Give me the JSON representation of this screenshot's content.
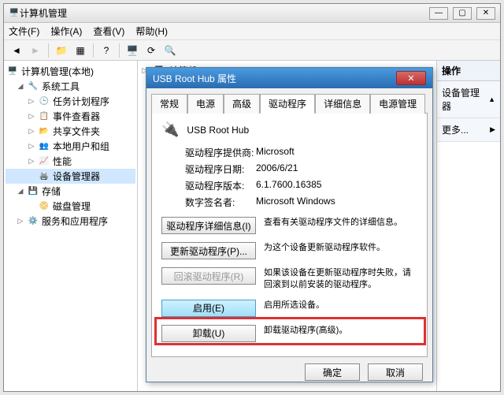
{
  "window": {
    "title": "计算机管理"
  },
  "menubar": {
    "file": "文件(F)",
    "action": "操作(A)",
    "view": "查看(V)",
    "help": "帮助(H)"
  },
  "tree": {
    "root": "计算机管理(本地)",
    "system_tools": "系统工具",
    "task_scheduler": "任务计划程序",
    "event_viewer": "事件查看器",
    "shared_folders": "共享文件夹",
    "local_users": "本地用户和组",
    "performance": "性能",
    "device_manager": "设备管理器",
    "storage": "存储",
    "disk_mgmt": "磁盘管理",
    "services": "服务和应用程序"
  },
  "middle": {
    "header": "计算机"
  },
  "right": {
    "header": "操作",
    "row1": "设备管理器",
    "row2": "更多..."
  },
  "dialog": {
    "title": "USB Root Hub 属性",
    "tabs": {
      "general": "常规",
      "power": "电源",
      "advanced": "高级",
      "driver": "驱动程序",
      "details": "详细信息",
      "power_mgmt": "电源管理"
    },
    "device_name": "USB Root Hub",
    "info": {
      "provider_label": "驱动程序提供商:",
      "provider_value": "Microsoft",
      "date_label": "驱动程序日期:",
      "date_value": "2006/6/21",
      "version_label": "驱动程序版本:",
      "version_value": "6.1.7600.16385",
      "signer_label": "数字签名者:",
      "signer_value": "Microsoft Windows"
    },
    "actions": {
      "details_btn": "驱动程序详细信息(I)",
      "details_desc": "查看有关驱动程序文件的详细信息。",
      "update_btn": "更新驱动程序(P)...",
      "update_desc": "为这个设备更新驱动程序软件。",
      "rollback_btn": "回滚驱动程序(R)",
      "rollback_desc": "如果该设备在更新驱动程序时失败，请回滚到以前安装的驱动程序。",
      "enable_btn": "启用(E)",
      "enable_desc": "启用所选设备。",
      "uninstall_btn": "卸载(U)",
      "uninstall_desc": "卸载驱动程序(高级)。"
    },
    "footer": {
      "ok": "确定",
      "cancel": "取消"
    }
  }
}
